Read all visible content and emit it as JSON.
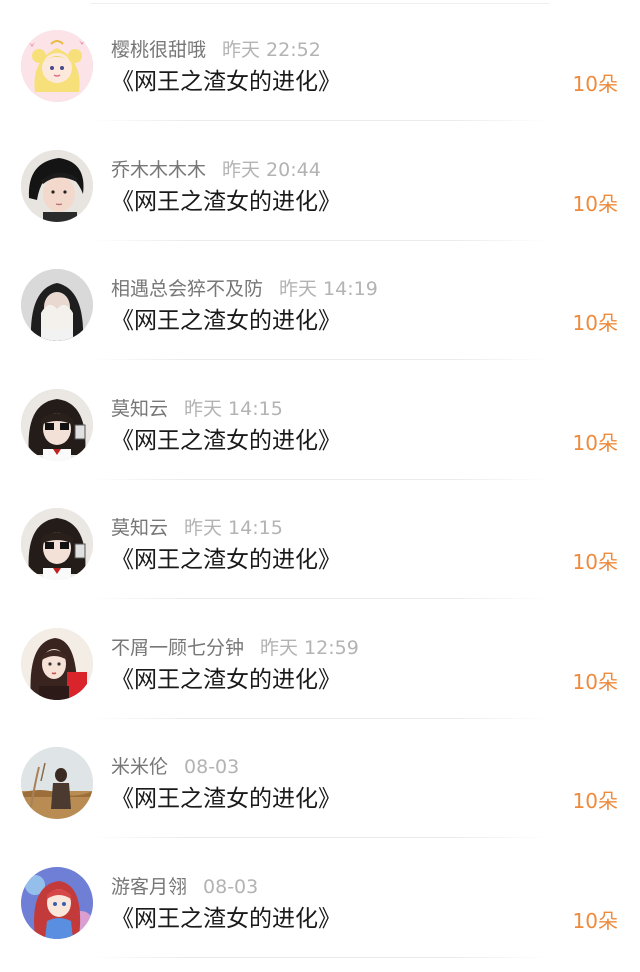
{
  "gift_list": {
    "items": [
      {
        "username": "樱桃很甜哦",
        "time": "昨天 22:52",
        "book_title": "《网王之渣女的进化》",
        "count": "10朵",
        "avatar": "sailor-moon-avatar"
      },
      {
        "username": "乔木木木木",
        "time": "昨天 20:44",
        "book_title": "《网王之渣女的进化》",
        "count": "10朵",
        "avatar": "dark-hair-avatar"
      },
      {
        "username": "相遇总会猝不及防",
        "time": "昨天 14:19",
        "book_title": "《网王之渣女的进化》",
        "count": "10朵",
        "avatar": "face-covered-avatar"
      },
      {
        "username": "莫知云",
        "time": "昨天 14:15",
        "book_title": "《网王之渣女的进化》",
        "count": "10朵",
        "avatar": "bangs-girl-avatar"
      },
      {
        "username": "莫知云",
        "time": "昨天 14:15",
        "book_title": "《网王之渣女的进化》",
        "count": "10朵",
        "avatar": "bangs-girl-avatar"
      },
      {
        "username": "不屑一顾七分钟",
        "time": "昨天 12:59",
        "book_title": "《网王之渣女的进化》",
        "count": "10朵",
        "avatar": "drawn-girl-avatar"
      },
      {
        "username": "米米伦",
        "time": "08-03",
        "book_title": "《网王之渣女的进化》",
        "count": "10朵",
        "avatar": "field-figure-avatar"
      },
      {
        "username": "游客月翎",
        "time": "08-03",
        "book_title": "《网王之渣女的进化》",
        "count": "10朵",
        "avatar": "anime-girl-avatar"
      }
    ]
  },
  "colors": {
    "username": "#777777",
    "time": "#b3b3b3",
    "title": "#1a1a1a",
    "count": "#ee8a3c"
  }
}
